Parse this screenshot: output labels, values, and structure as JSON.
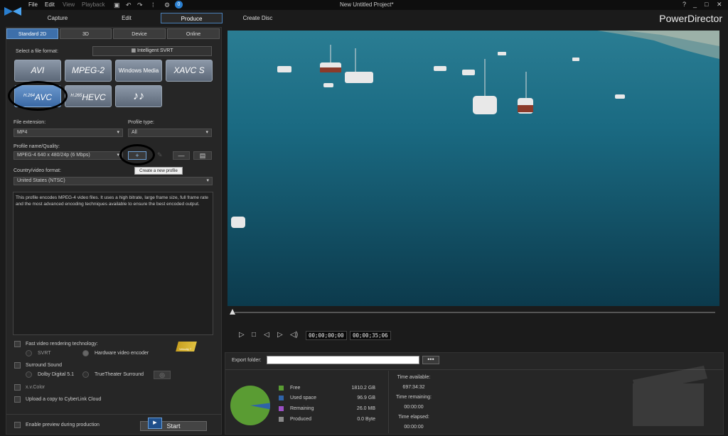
{
  "app": {
    "project_title": "New Untitled Project*",
    "brand": "PowerDirector",
    "menu": [
      "File",
      "Edit",
      "View",
      "Playback"
    ],
    "help": "?",
    "minimize": "_",
    "restore": "□",
    "close": "✕"
  },
  "mode_tabs": [
    "Capture",
    "Edit",
    "Produce",
    "Create Disc"
  ],
  "active_mode": "Produce",
  "format_tabs": [
    "Standard 2D",
    "3D",
    "Device",
    "Online"
  ],
  "select_format_label": "Select a file format:",
  "intelligent_svrt": "Intelligent SVRT",
  "formats": {
    "avi": "AVI",
    "mpeg2": "MPEG-2",
    "wmv": "Windows Media",
    "xavcs": "XAVC S",
    "avc_prefix": "H.264",
    "avc": "AVC",
    "hevc_prefix": "H.265",
    "hevc": "HEVC",
    "audio": "♪♪"
  },
  "file_extension": {
    "label": "File extension:",
    "value": "MP4"
  },
  "profile_type": {
    "label": "Profile type:",
    "value": "All"
  },
  "profile_name": {
    "label": "Profile name/Quality:",
    "value": "MPEG-4 640 x 480/24p (6 Mbps)"
  },
  "profile_buttons": {
    "add": "+",
    "remove": "—"
  },
  "tooltip": "Create a new profile",
  "country": {
    "label": "Country/video format:",
    "value": "United States (NTSC)"
  },
  "description": "This profile encodes MPEG-4 video files. It uses a high bitrate, large frame size, full frame rate and the most advanced encoding techniques available to ensure the best encoded output.",
  "options": {
    "fast_render": "Fast video rendering technology:",
    "svrt": "SVRT",
    "hw_encoder": "Hardware video encoder",
    "velocity": "Velocity 7",
    "surround": "Surround Sound",
    "dolby": "Dolby Digital 5.1",
    "truetheater": "TrueTheater Surround",
    "xvcolor": "x.v.Color",
    "upload": "Upload a copy to CyberLink Cloud",
    "enable_preview": "Enable preview during production",
    "start": "Start"
  },
  "timecode": {
    "current": "00;00;00;00",
    "total": "00;00;35;06"
  },
  "export_folder_label": "Export folder:",
  "browse": "•••",
  "disk": {
    "legend": [
      {
        "label": "Free",
        "value": "1810.2 GB",
        "color": "#5a9c33"
      },
      {
        "label": "Used space",
        "value": "96.9 GB",
        "color": "#2f63a8"
      },
      {
        "label": "Remaining",
        "value": "26.0 MB",
        "color": "#9a4fc4"
      },
      {
        "label": "Produced",
        "value": "0.0 Byte",
        "color": "#888888"
      }
    ],
    "used_fraction": 0.051
  },
  "times": {
    "available_label": "Time available:",
    "available": "697:34:32",
    "remaining_label": "Time remaining:",
    "remaining": "00:00:00",
    "elapsed_label": "Time elapsed:",
    "elapsed": "00:00:00"
  }
}
